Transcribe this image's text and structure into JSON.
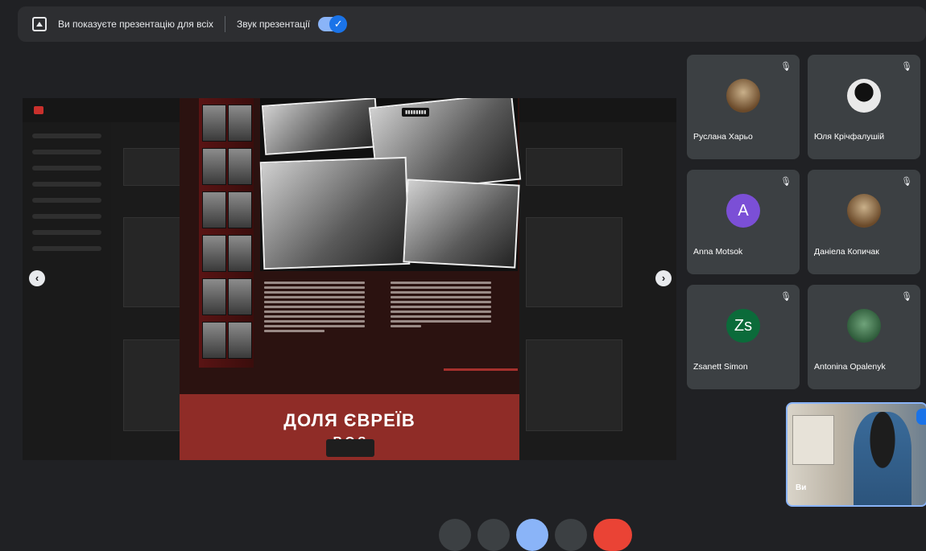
{
  "topbar": {
    "presenting_text": "Ви показуєте презентацію для всіх",
    "sound_label": "Звук презентації",
    "sound_toggle_state": "on"
  },
  "slide": {
    "title": "ДОЛЯ ЄВРЕЇВ",
    "subtitle": "R   Q   S"
  },
  "participants": [
    {
      "name": "Руслана Харьо",
      "avatar": "photo",
      "mic": "muted"
    },
    {
      "name": "Юля Крічфалушій",
      "avatar": "photo",
      "mic": "muted"
    },
    {
      "name": "Anna Motsok",
      "avatar": "A",
      "avatar_color": "#7b4fd6",
      "mic": "muted"
    },
    {
      "name": "Даніела Копичак",
      "avatar": "photo",
      "mic": "muted"
    },
    {
      "name": "Zsanett Simon",
      "avatar": "Zs",
      "avatar_color": "#0b6b3a",
      "mic": "muted"
    },
    {
      "name": "Antonina Opalenyk",
      "avatar": "photo",
      "mic": "muted"
    }
  ],
  "self_view": {
    "label": "Ви"
  },
  "colors": {
    "accent": "#8ab4f8",
    "slide_red": "#8f2c27",
    "leave_red": "#ea4335"
  }
}
